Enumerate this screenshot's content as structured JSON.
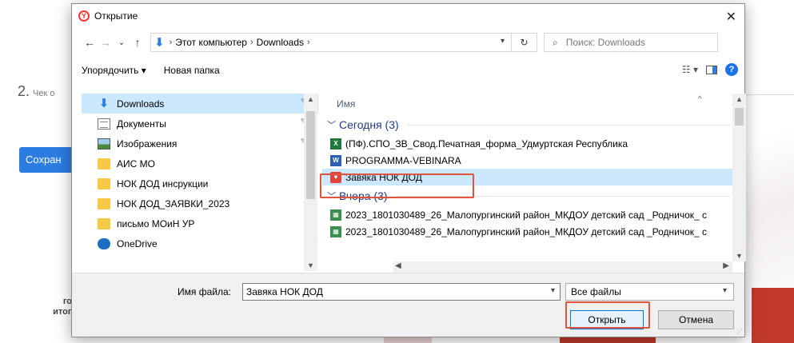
{
  "background": {
    "step_number": "2.",
    "step_text": "Чек о",
    "save_button": "Сохран",
    "footer_text_1": "гос",
    "footer_text_2": "итого"
  },
  "dialog": {
    "title": "Открытие",
    "close_label": "✕",
    "nav": {
      "back": "←",
      "forward": "→",
      "recent": "⌄",
      "up": "↑"
    },
    "address": {
      "crumbs": [
        "Этот компьютер",
        "Downloads"
      ],
      "separator": "›"
    },
    "refresh_label": "↻",
    "search_placeholder": "Поиск: Downloads",
    "toolbar": {
      "organize": "Упорядочить ▾",
      "new_folder": "Новая папка",
      "view_label": "☷ ▾",
      "help_label": "?"
    },
    "sidebar": {
      "items": [
        {
          "label": "Downloads",
          "icon": "download-arrow-icon",
          "pinned": true,
          "selected": true
        },
        {
          "label": "Документы",
          "icon": "documents-icon",
          "pinned": true
        },
        {
          "label": "Изображения",
          "icon": "pictures-icon",
          "pinned": true
        },
        {
          "label": "АИС МО",
          "icon": "folder-icon"
        },
        {
          "label": "НОК ДОД инсрукции",
          "icon": "folder-icon"
        },
        {
          "label": "НОК ДОД_ЗАЯВКИ_2023",
          "icon": "folder-icon"
        },
        {
          "label": "письмо МОиН УР",
          "icon": "folder-icon"
        },
        {
          "label": "OneDrive",
          "icon": "cloud-icon"
        }
      ],
      "pin_glyph": "📌"
    },
    "files": {
      "column_name": "Имя",
      "groups": [
        {
          "label": "Сегодня (3)",
          "items": [
            {
              "name": "(ПФ).СПО_ЗВ_Свод.Печатная_форма_Удмуртская Республика",
              "type": "xls"
            },
            {
              "name": "PROGRAMMA-VEBINARA",
              "type": "doc"
            },
            {
              "name": "Завяка НОК ДОД",
              "type": "pdf",
              "selected": true
            }
          ]
        },
        {
          "label": "Вчера (3)",
          "items": [
            {
              "name": "2023_1801030489_26_Малопургинский район_МКДОУ детский сад _Родничок_ с",
              "type": "img"
            },
            {
              "name": "2023_1801030489_26_Малопургинский район_МКДОУ детский сад _Родничок_ с",
              "type": "img"
            }
          ]
        }
      ]
    },
    "bottom": {
      "filename_label": "Имя файла:",
      "filename_value": "Завяка НОК ДОД",
      "filetype_value": "Все файлы",
      "open_button": "Открыть",
      "cancel_button": "Отмена"
    }
  }
}
